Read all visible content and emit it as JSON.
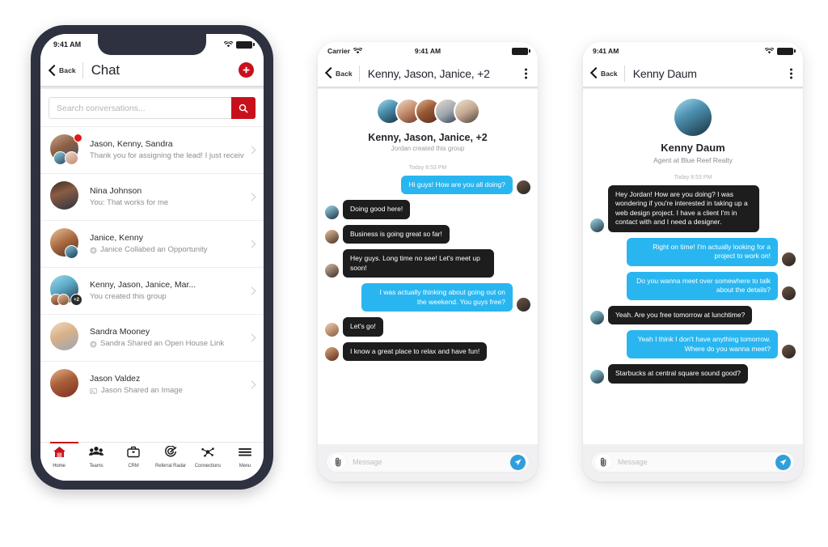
{
  "phone1": {
    "status": {
      "time": "9:41 AM",
      "wifi_icon": "wifi-icon",
      "battery_icon": "battery-icon"
    },
    "nav": {
      "back_label": "Back",
      "title": "Chat",
      "add_icon": "plus-circle-icon"
    },
    "search": {
      "placeholder": "Search conversations...",
      "value": "",
      "button_icon": "search-icon"
    },
    "conversations": [
      {
        "title": "Jason, Kenny, Sandra",
        "preview": "Thank you for assigning the lead! I just receiv...",
        "unread": true,
        "avatar_type": "group3",
        "preview_icon": ""
      },
      {
        "title": "Nina Johnson",
        "preview": "You: That works for me",
        "unread": false,
        "avatar_type": "single",
        "preview_icon": ""
      },
      {
        "title": "Janice, Kenny",
        "preview": "Janice Collabed an Opportunity",
        "unread": false,
        "avatar_type": "group2",
        "preview_icon": "collab-icon"
      },
      {
        "title": "Kenny, Jason, Janice, Mar...",
        "preview": "You created this group",
        "unread": false,
        "avatar_type": "groupmore",
        "overflow_badge": "+2",
        "preview_icon": ""
      },
      {
        "title": "Sandra Mooney",
        "preview": "Sandra Shared an Open House Link",
        "unread": false,
        "avatar_type": "single",
        "preview_icon": "link-icon"
      },
      {
        "title": "Jason Valdez",
        "preview": "Jason Shared an Image",
        "unread": false,
        "avatar_type": "single",
        "preview_icon": "image-icon"
      }
    ],
    "tabs": [
      {
        "label": "Home",
        "icon": "home-icon",
        "active": true
      },
      {
        "label": "Teams",
        "icon": "teams-icon",
        "active": false
      },
      {
        "label": "CRM",
        "icon": "briefcase-icon",
        "active": false
      },
      {
        "label": "Referral Radar",
        "icon": "radar-icon",
        "active": false
      },
      {
        "label": "Connections",
        "icon": "network-icon",
        "active": false
      },
      {
        "label": "Menu",
        "icon": "hamburger-icon",
        "active": false
      }
    ]
  },
  "phone2": {
    "status": {
      "carrier": "Carrier",
      "time": "9:41 AM",
      "wifi_icon": "wifi-icon",
      "battery_icon": "battery-icon"
    },
    "nav": {
      "back_label": "Back",
      "title": "Kenny, Jason, Janice, +2",
      "menu_icon": "kebab-menu-icon"
    },
    "header": {
      "title": "Kenny, Jason, Janice, +2",
      "subtitle": "Jordan created this group",
      "avatar_count": 5
    },
    "timestamp": "Today 8:53 PM",
    "messages": [
      {
        "side": "out",
        "text": "Hi guys! How are you all doing?",
        "avatar": "jordan"
      },
      {
        "side": "in",
        "text": "Doing good here!",
        "avatar": "kenny"
      },
      {
        "side": "in",
        "text": "Business is going great so far!",
        "avatar": "janice"
      },
      {
        "side": "in",
        "text": "Hey guys. Long time no see! Let's meet up soon!",
        "avatar": "marie"
      },
      {
        "side": "out",
        "text": "I was actually thinking about going out on the weekend. You guys free?",
        "avatar": "jordan"
      },
      {
        "side": "in",
        "text": "Let's go!",
        "avatar": "jason"
      },
      {
        "side": "in",
        "text": "I know a great place to relax and have fun!",
        "avatar": "mike"
      }
    ],
    "composer": {
      "placeholder": "Message",
      "value": "",
      "attach_icon": "paperclip-icon",
      "send_icon": "send-icon"
    }
  },
  "phone3": {
    "status": {
      "time": "9:41 AM",
      "wifi_icon": "wifi-icon",
      "battery_icon": "battery-icon"
    },
    "nav": {
      "back_label": "Back",
      "title": "Kenny Daum",
      "menu_icon": "kebab-menu-icon"
    },
    "header": {
      "title": "Kenny Daum",
      "subtitle": "Agent at Blue Reef Realty"
    },
    "timestamp": "Today 8:53 PM",
    "messages": [
      {
        "side": "in",
        "text": "Hey Jordan! How are you doing? I was wondering if you're interested in taking up a web design project. I have a client I'm in contact with and I need a designer.",
        "avatar": "kenny"
      },
      {
        "side": "out",
        "text": "Right on time! I'm actually looking for a project to work on!",
        "avatar": "jordan"
      },
      {
        "side": "out",
        "text": "Do you wanna meet over somewhere to talk about the details?",
        "avatar": "jordan"
      },
      {
        "side": "in",
        "text": "Yeah. Are you free tomorrow at lunchtime?",
        "avatar": "kenny"
      },
      {
        "side": "out",
        "text": "Yeah I think I don't have anything tomorrow. Where do you wanna meet?",
        "avatar": "jordan"
      },
      {
        "side": "in",
        "text": "Starbucks at central square sound good?",
        "avatar": "kenny"
      }
    ],
    "composer": {
      "placeholder": "Message",
      "value": "",
      "attach_icon": "paperclip-icon",
      "send_icon": "send-icon"
    }
  },
  "colors": {
    "brand_red": "#c8101a",
    "bubble_out": "#29b6f0",
    "bubble_in": "#1d1d1d",
    "device_frame": "#2e3140",
    "unread_dot": "#e01b1b"
  }
}
